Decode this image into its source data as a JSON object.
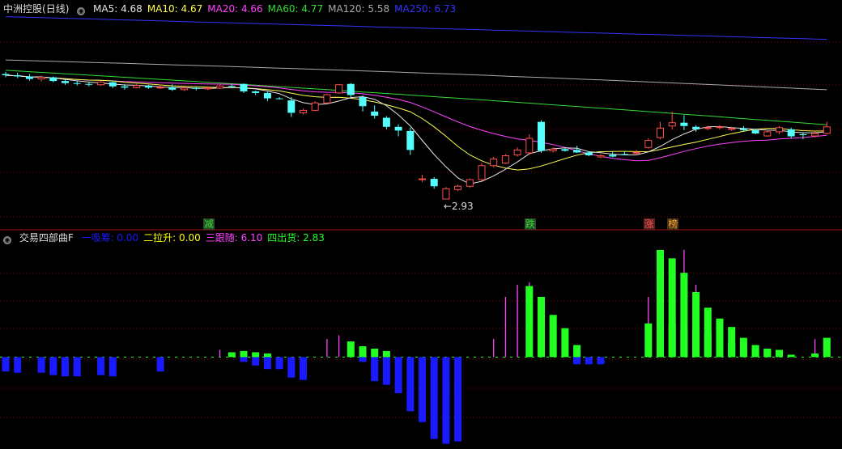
{
  "colors": {
    "up": "#ff4d4d",
    "down": "#54ffff",
    "ma5": "#e6e6e6",
    "ma10": "#ffff4d",
    "ma20": "#ff44ff",
    "ma60": "#33dd33",
    "ma120": "#aaaaaa",
    "ma250": "#3333ff",
    "grid": "#8b0000",
    "ind1": "#1a1aff",
    "ind2": "#ffff00",
    "ind3": "#ff44ff",
    "ind4": "#22ff22"
  },
  "header": {
    "stock": "中洲控股",
    "period": "(日线)",
    "ma": [
      {
        "label": "MA5: 4.68",
        "key": "ma5"
      },
      {
        "label": "MA10: 4.67",
        "key": "ma10"
      },
      {
        "label": "MA20: 4.66",
        "key": "ma20"
      },
      {
        "label": "MA60: 4.77",
        "key": "ma60"
      },
      {
        "label": "MA120: 5.58",
        "key": "ma120"
      },
      {
        "label": "MA250: 6.73",
        "key": "ma250"
      }
    ]
  },
  "indicator_header": {
    "name": "交易四部曲F",
    "items": [
      {
        "label": "一吸筹: 0.00",
        "key": "ind1"
      },
      {
        "label": "二拉升: 0.00",
        "key": "ind2"
      },
      {
        "label": "三跟随: 6.10",
        "key": "ind3"
      },
      {
        "label": "四出货: 2.83",
        "key": "ind4"
      }
    ]
  },
  "markers": [
    {
      "text": "减",
      "color": "#33dd33",
      "bg": "#2a4a2a",
      "i": 17
    },
    {
      "text": "跌",
      "color": "#33dd33",
      "bg": "#2a4a2a",
      "i": 44
    },
    {
      "text": "涨",
      "color": "#ff5555",
      "bg": "#5a2020",
      "i": 54
    },
    {
      "text": "榜",
      "color": "#ffaa33",
      "bg": "#4a3015",
      "i": 56
    }
  ],
  "low_label": "←2.93",
  "chart_data": [
    {
      "type": "candlestick",
      "x_count": 70,
      "ylim": [
        2.5,
        7.4
      ],
      "ohlc": [
        [
          5.96,
          6.01,
          5.88,
          5.93
        ],
        [
          5.93,
          5.99,
          5.86,
          5.9
        ],
        [
          5.9,
          5.96,
          5.8,
          5.84
        ],
        [
          5.84,
          5.92,
          5.78,
          5.88
        ],
        [
          5.88,
          5.9,
          5.76,
          5.79
        ],
        [
          5.79,
          5.84,
          5.7,
          5.74
        ],
        [
          5.74,
          5.8,
          5.68,
          5.72
        ],
        [
          5.72,
          5.76,
          5.66,
          5.7
        ],
        [
          5.7,
          5.79,
          5.67,
          5.76
        ],
        [
          5.76,
          5.8,
          5.62,
          5.66
        ],
        [
          5.66,
          5.72,
          5.58,
          5.63
        ],
        [
          5.63,
          5.72,
          5.61,
          5.68
        ],
        [
          5.68,
          5.7,
          5.6,
          5.63
        ],
        [
          5.63,
          5.7,
          5.6,
          5.64
        ],
        [
          5.64,
          5.71,
          5.55,
          5.58
        ],
        [
          5.58,
          5.65,
          5.55,
          5.62
        ],
        [
          5.62,
          5.66,
          5.56,
          5.6
        ],
        [
          5.6,
          5.66,
          5.57,
          5.62
        ],
        [
          5.62,
          5.7,
          5.6,
          5.67
        ],
        [
          5.67,
          5.72,
          5.62,
          5.66
        ],
        [
          5.72,
          5.73,
          5.5,
          5.54
        ],
        [
          5.54,
          5.56,
          5.45,
          5.5
        ],
        [
          5.5,
          5.53,
          5.3,
          5.37
        ],
        [
          5.37,
          5.4,
          5.34,
          5.36
        ],
        [
          5.32,
          5.4,
          4.92,
          5.02
        ],
        [
          5.02,
          5.12,
          4.98,
          5.08
        ],
        [
          5.08,
          5.3,
          5.06,
          5.26
        ],
        [
          5.26,
          5.48,
          5.24,
          5.46
        ],
        [
          5.5,
          5.72,
          5.48,
          5.7
        ],
        [
          5.72,
          5.74,
          5.4,
          5.45
        ],
        [
          5.4,
          5.44,
          5.05,
          5.18
        ],
        [
          5.05,
          5.2,
          4.88,
          4.95
        ],
        [
          4.9,
          4.94,
          4.62,
          4.68
        ],
        [
          4.68,
          4.74,
          4.45,
          4.59
        ],
        [
          4.58,
          4.66,
          4.0,
          4.12
        ],
        [
          3.4,
          3.52,
          3.34,
          3.42
        ],
        [
          3.42,
          3.46,
          3.18,
          3.24
        ],
        [
          2.93,
          3.22,
          2.93,
          3.18
        ],
        [
          3.16,
          3.28,
          3.12,
          3.24
        ],
        [
          3.24,
          3.43,
          3.2,
          3.4
        ],
        [
          3.4,
          3.8,
          3.36,
          3.74
        ],
        [
          3.74,
          3.95,
          3.7,
          3.9
        ],
        [
          3.8,
          4.02,
          3.78,
          3.98
        ],
        [
          4.0,
          4.18,
          3.96,
          4.12
        ],
        [
          4.05,
          4.5,
          4.0,
          4.4
        ],
        [
          4.8,
          4.84,
          4.05,
          4.1
        ],
        [
          4.1,
          4.18,
          4.06,
          4.14
        ],
        [
          4.14,
          4.16,
          4.08,
          4.1
        ],
        [
          4.12,
          4.22,
          4.05,
          4.06
        ],
        [
          4.06,
          4.09,
          3.97,
          3.99
        ],
        [
          3.95,
          4.02,
          3.92,
          3.98
        ],
        [
          4.0,
          4.08,
          3.94,
          3.96
        ],
        [
          4.02,
          4.08,
          3.99,
          4.01
        ],
        [
          4.05,
          4.12,
          4.0,
          4.06
        ],
        [
          4.18,
          4.4,
          4.15,
          4.35
        ],
        [
          4.42,
          4.8,
          4.38,
          4.65
        ],
        [
          4.7,
          5.05,
          4.62,
          4.78
        ],
        [
          4.78,
          4.96,
          4.6,
          4.7
        ],
        [
          4.68,
          4.72,
          4.56,
          4.62
        ],
        [
          4.64,
          4.7,
          4.6,
          4.66
        ],
        [
          4.66,
          4.72,
          4.62,
          4.68
        ],
        [
          4.62,
          4.68,
          4.58,
          4.64
        ],
        [
          4.64,
          4.7,
          4.56,
          4.6
        ],
        [
          4.6,
          4.64,
          4.5,
          4.52
        ],
        [
          4.46,
          4.58,
          4.44,
          4.56
        ],
        [
          4.56,
          4.7,
          4.5,
          4.66
        ],
        [
          4.62,
          4.66,
          4.4,
          4.45
        ],
        [
          4.5,
          4.55,
          4.38,
          4.49
        ],
        [
          4.46,
          4.56,
          4.42,
          4.52
        ],
        [
          4.52,
          4.8,
          4.5,
          4.68
        ]
      ],
      "extra_candles": [
        [
          4.5,
          4.62,
          4.46,
          4.58
        ],
        [
          4.58,
          4.72,
          4.52,
          4.68
        ],
        [
          4.72,
          4.8,
          4.58,
          4.6
        ]
      ]
    },
    {
      "type": "bar",
      "x_count": 70,
      "ylim": [
        -7.5,
        9.5
      ],
      "series": [
        {
          "key": "ind1",
          "values": [
            -1.2,
            -1.3,
            0,
            -1.3,
            -1.5,
            -1.6,
            -1.6,
            0,
            -1.5,
            -1.6,
            0,
            0,
            0,
            -1.2,
            0,
            0,
            0,
            0,
            0,
            0,
            -0.4,
            -0.7,
            -1.0,
            -1.0,
            -1.7,
            -1.9,
            0,
            0,
            0,
            0,
            -0.4,
            -2.0,
            -2.3,
            -3.0,
            -4.5,
            -5.4,
            -6.8,
            -7.2,
            -7.0,
            0,
            0,
            0,
            0,
            0,
            0,
            0,
            0,
            0,
            -0.6,
            -0.6,
            -0.6,
            0,
            0,
            0,
            0,
            0,
            0,
            0,
            0,
            0,
            0,
            0,
            0,
            0,
            0,
            0,
            0,
            0,
            0,
            0
          ]
        },
        {
          "key": "ind3",
          "values": [
            0,
            0,
            0,
            0,
            0,
            0,
            0,
            0,
            0,
            0,
            0,
            0,
            0,
            0,
            0,
            0,
            0,
            0,
            0.6,
            0,
            0,
            0,
            0,
            0,
            0,
            0,
            0,
            1.5,
            1.8,
            0,
            0,
            0,
            0,
            0,
            0,
            0,
            0,
            0,
            0,
            0,
            0,
            1.5,
            5.0,
            6.0,
            6.2,
            0,
            0,
            0,
            0,
            0,
            0,
            0,
            0,
            0,
            5.0,
            8.3,
            7.5,
            8.9,
            6.0,
            0,
            0,
            0,
            0,
            0,
            0,
            0,
            0,
            0,
            1.5,
            0
          ]
        },
        {
          "key": "ind4",
          "values": [
            0,
            0,
            0,
            0,
            0,
            0,
            0,
            0,
            0,
            0,
            0,
            0,
            0,
            0,
            0,
            0,
            0,
            0,
            0,
            0.4,
            0.5,
            0.4,
            0.3,
            0,
            0,
            0,
            0,
            0,
            0,
            1.3,
            0.9,
            0.7,
            0.5,
            0,
            0,
            0,
            0,
            0,
            0,
            0,
            0,
            0,
            0,
            0,
            5.9,
            5.0,
            3.5,
            2.4,
            1.0,
            0,
            0,
            0,
            0,
            0,
            2.8,
            8.9,
            8.2,
            7.0,
            5.4,
            4.1,
            3.2,
            2.5,
            1.6,
            1.0,
            0.6,
            0.4,
            0.2,
            0,
            0.3,
            1.6
          ]
        },
        {
          "key": "ind4",
          "values": [
            0,
            0,
            0,
            0,
            0,
            0,
            0,
            0,
            0,
            0,
            0,
            0,
            0,
            0,
            0,
            0,
            0,
            0,
            0,
            0,
            0,
            0,
            0,
            0,
            0,
            0,
            0,
            0,
            0,
            0,
            0,
            0,
            0,
            0,
            0,
            0,
            0,
            0,
            0,
            0,
            0,
            0,
            0,
            0,
            0,
            0,
            0,
            0,
            0,
            0,
            0,
            0,
            0,
            0,
            0,
            2.8,
            2.8,
            2.3,
            2.3,
            2.0,
            1.6,
            1.2,
            0.8,
            0.7,
            0.7,
            0.6,
            0,
            0,
            0,
            0
          ]
        }
      ]
    }
  ]
}
